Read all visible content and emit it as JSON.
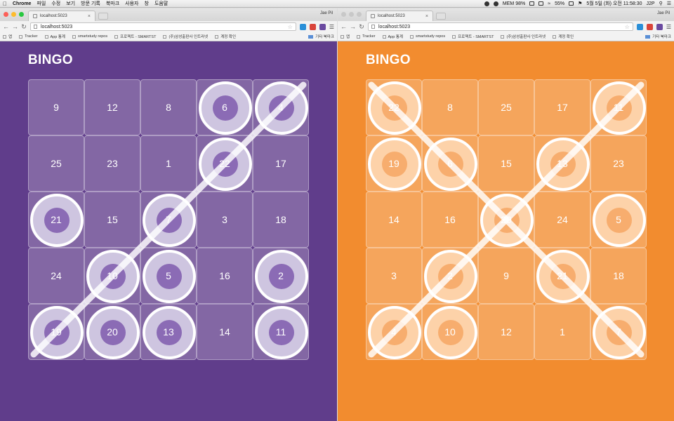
{
  "menubar": {
    "app": "Chrome",
    "items": [
      "파일",
      "수정",
      "보기",
      "방문 기록",
      "북마크",
      "사용자",
      "창",
      "도움말"
    ],
    "mem": "MEM 98%",
    "battery": "55%",
    "datetime": "5월 5일 (화) 오전 11:58:30",
    "user": "J2P"
  },
  "browsers": [
    {
      "tab_title": "localhost:5023",
      "profile": "Jae Pil",
      "url": "localhost:5023",
      "bookmarks": [
        "앱",
        "Tracker",
        "App 통계",
        "smartstudy repos",
        "프로젝트 - SMARTST",
        "(주)삼성출판사 인트라넷",
        "계정 확인"
      ],
      "other_bookmarks": "기타 북마크",
      "page_title": "BINGO",
      "theme": "purple",
      "accent": "#603d8b",
      "grid": [
        [
          9,
          12,
          8,
          6,
          4
        ],
        [
          25,
          23,
          1,
          22,
          17
        ],
        [
          21,
          15,
          7,
          3,
          18
        ],
        [
          24,
          10,
          5,
          16,
          2
        ],
        [
          19,
          20,
          13,
          14,
          11
        ]
      ],
      "marked": [
        [
          false,
          false,
          false,
          true,
          true
        ],
        [
          false,
          false,
          false,
          true,
          false
        ],
        [
          true,
          false,
          true,
          false,
          false
        ],
        [
          false,
          true,
          true,
          false,
          true
        ],
        [
          true,
          true,
          true,
          false,
          true
        ]
      ],
      "bingo_lines": [
        "anti-diagonal"
      ]
    },
    {
      "tab_title": "localhost:5023",
      "profile": "Jae Pil",
      "url": "localhost:5023",
      "bookmarks": [
        "앱",
        "Tracker",
        "App 통계",
        "smartstudy repos",
        "프로젝트 - SMARTST",
        "(주)삼성출판사 인트라넷",
        "계정 확인"
      ],
      "other_bookmarks": "기타 북마크",
      "page_title": "BINGO",
      "theme": "orange",
      "accent": "#f28c2f",
      "grid": [
        [
          22,
          8,
          25,
          17,
          11
        ],
        [
          19,
          6,
          15,
          13,
          23
        ],
        [
          14,
          16,
          20,
          24,
          5
        ],
        [
          3,
          2,
          9,
          21,
          18
        ],
        [
          4,
          10,
          12,
          1,
          7
        ]
      ],
      "marked": [
        [
          true,
          false,
          false,
          false,
          true
        ],
        [
          true,
          true,
          false,
          true,
          false
        ],
        [
          false,
          false,
          true,
          false,
          true
        ],
        [
          false,
          true,
          false,
          true,
          false
        ],
        [
          true,
          true,
          false,
          false,
          true
        ]
      ],
      "bingo_lines": [
        "main-diagonal",
        "anti-diagonal"
      ]
    }
  ]
}
